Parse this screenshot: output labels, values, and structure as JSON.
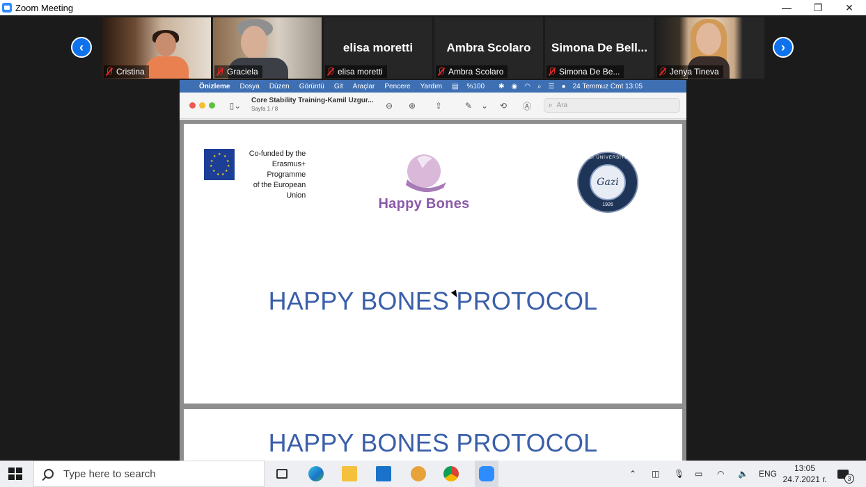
{
  "window": {
    "title": "Zoom Meeting",
    "minimize": "—",
    "restore": "❐",
    "close": "✕"
  },
  "gallery": {
    "prev": "‹",
    "next": "›",
    "participants": [
      {
        "name": "Cristina",
        "display": ""
      },
      {
        "name": "Graciela",
        "display": ""
      },
      {
        "name": "elisa moretti",
        "display": "elisa moretti"
      },
      {
        "name": "Ambra Scolaro",
        "display": "Ambra Scolaro"
      },
      {
        "name": "Simona De Be...",
        "display": "Simona De Bell..."
      },
      {
        "name": "Jenya Tineva",
        "display": ""
      }
    ]
  },
  "mac_menu": {
    "apple": "",
    "app": "Önizleme",
    "items": [
      "Dosya",
      "Düzen",
      "Görüntü",
      "Git",
      "Araçlar",
      "Pencere",
      "Yardım"
    ],
    "battery": "%100",
    "datetime": "24 Temmuz Cmt  13:05"
  },
  "preview": {
    "doc_name": "Core Stability Training-Kamil Uzgur...",
    "page_info": "Sayfa 1 / 8",
    "search_placeholder": "Ara"
  },
  "document": {
    "eu_text": "Co-funded by the Erasmus+ Programme of the European Union",
    "eu_line1": "Co-funded by the",
    "eu_line2": "Erasmus+ Programme",
    "eu_line3": "of the European Union",
    "logo_text": "Happy Bones",
    "seal_ring": "GAZİ ÜNİVERSİTESİ",
    "seal_sig": "Gazi",
    "seal_year": "1926",
    "heading": "HAPPY BONES PROTOCOL",
    "heading_page2": "HAPPY BONES PROTOCOL"
  },
  "taskbar": {
    "search_placeholder": "Type here to search",
    "lang": "ENG",
    "time": "13:05",
    "date": "24.7.2021 г.",
    "notifications": "3"
  },
  "colors": {
    "zoom_blue": "#0e72ed",
    "mac_menu": "#3f6fb3",
    "heading_blue": "#3a5fa9",
    "logo_purple": "#8a5aa8"
  }
}
